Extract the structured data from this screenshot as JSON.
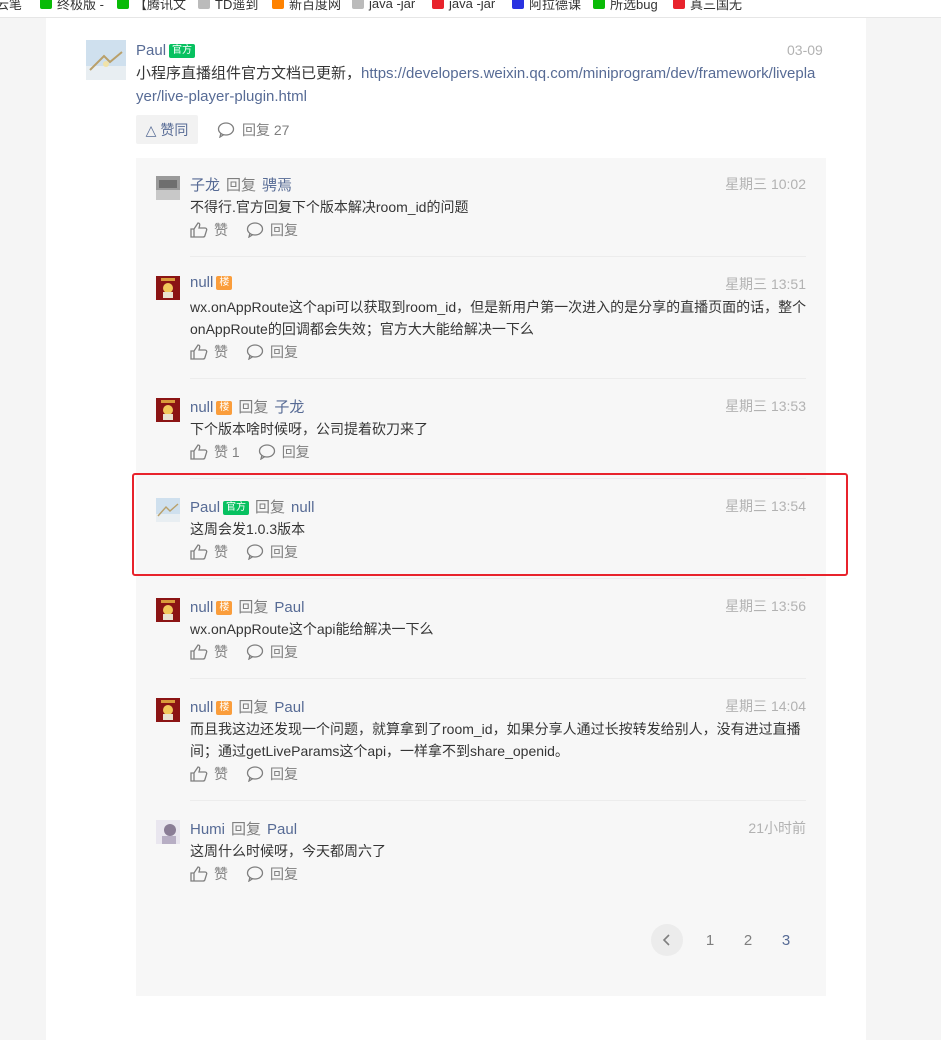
{
  "bookmarks": [
    {
      "label": "云笔",
      "icon": "note-icon"
    },
    {
      "label": "终极版 -",
      "icon": "s-icon",
      "color": "#09bb07"
    },
    {
      "label": "【腾讯文",
      "icon": "plus-icon",
      "color": "#09bb07"
    },
    {
      "label": "TD遥到",
      "icon": "star-icon"
    },
    {
      "label": "新百度网",
      "icon": "weibo-icon",
      "color": "#ff8200"
    },
    {
      "label": "java -jar",
      "icon": "java-icon"
    },
    {
      "label": "java -jar",
      "icon": "c-icon",
      "color": "#e8232c"
    },
    {
      "label": "阿拉德课",
      "icon": "paw-icon",
      "color": "#2932e1"
    },
    {
      "label": "所选bug",
      "icon": "plus-icon",
      "color": "#09bb07"
    },
    {
      "label": "真三国无",
      "icon": "g-icon",
      "color": "#e8232c"
    }
  ],
  "main_post": {
    "author": "Paul",
    "badge": "官方",
    "time": "03-09",
    "text": "小程序直播组件官方文档已更新，",
    "link": "https://developers.weixin.qq.com/miniprogram/dev/framework/liveplayer/live-player-plugin.html",
    "like_label": "△ 赞同",
    "reply_label": "回复 27"
  },
  "replies": [
    {
      "author": "子龙",
      "badge": "",
      "reply_word": "回复",
      "reply_to": "骋焉",
      "time": "星期三 10:02",
      "content": "不得行.官方回复下个版本解决room_id的问题",
      "like": "赞",
      "reply": "回复",
      "avatar": "grey"
    },
    {
      "author": "null",
      "badge": "楼",
      "reply_word": "",
      "reply_to": "",
      "time": "星期三 13:51",
      "content": "wx.onAppRoute这个api可以获取到room_id，但是新用户第一次进入的是分享的直播页面的话，整个onAppRoute的回调都会失效；官方大大能给解决一下么",
      "like": "赞",
      "reply": "回复",
      "avatar": "red"
    },
    {
      "author": "null",
      "badge": "楼",
      "reply_word": "回复",
      "reply_to": "子龙",
      "time": "星期三 13:53",
      "content": "下个版本啥时候呀，公司提着砍刀来了",
      "like": "赞 1",
      "reply": "回复",
      "avatar": "red"
    },
    {
      "author": "Paul",
      "badge": "官方",
      "reply_word": "回复",
      "reply_to": "null",
      "time": "星期三 13:54",
      "content": "这周会发1.0.3版本",
      "like": "赞",
      "reply": "回复",
      "avatar": "paul"
    },
    {
      "author": "null",
      "badge": "楼",
      "reply_word": "回复",
      "reply_to": "Paul",
      "time": "星期三 13:56",
      "content": "wx.onAppRoute这个api能给解决一下么",
      "like": "赞",
      "reply": "回复",
      "avatar": "red"
    },
    {
      "author": "null",
      "badge": "楼",
      "reply_word": "回复",
      "reply_to": "Paul",
      "time": "星期三 14:04",
      "content": "而且我这边还发现一个问题，就算拿到了room_id，如果分享人通过长按转发给别人，没有进过直播间；通过getLiveParams这个api，一样拿不到share_openid。",
      "like": "赞",
      "reply": "回复",
      "avatar": "red"
    },
    {
      "author": "Humi",
      "badge": "",
      "reply_word": "回复",
      "reply_to": "Paul",
      "time": "21小时前",
      "content": "这周什么时候呀，今天都周六了",
      "like": "赞",
      "reply": "回复",
      "avatar": "humi"
    }
  ],
  "pagination": {
    "prev_icon": "chevron-left-icon",
    "pages": [
      "1",
      "2",
      "3"
    ]
  },
  "colors": {
    "link": "#576b95",
    "official": "#07c160",
    "floor": "#fa9d3b",
    "highlight": "#e8232c"
  }
}
